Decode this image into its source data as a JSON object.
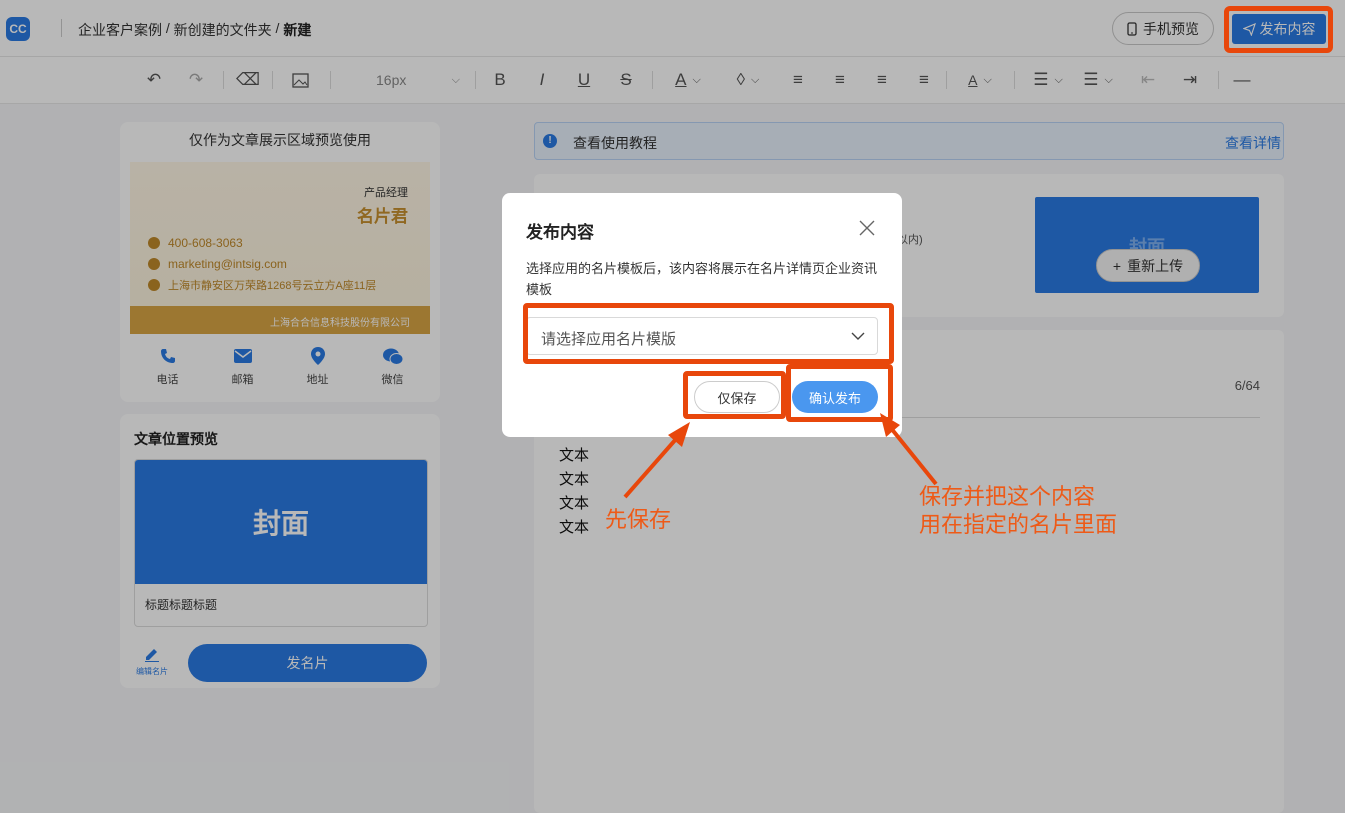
{
  "app": {
    "logo": "CC"
  },
  "breadcrumb": {
    "part1": "企业客户案例",
    "sep": " / ",
    "part2": "新创建的文件夹",
    "current": "新建"
  },
  "header": {
    "mobile_preview": "手机预览",
    "publish": "发布内容"
  },
  "toolbar": {
    "font_size": "16px",
    "icons": [
      "undo-icon",
      "redo-icon",
      "eraser-icon",
      "image-icon",
      "bold-icon",
      "italic-icon",
      "underline-icon",
      "strikethrough-icon",
      "font-color-icon",
      "highlight-icon",
      "align-left-icon",
      "align-center-icon",
      "align-right-icon",
      "justify-icon",
      "text-style-icon",
      "bullet-list-icon",
      "ordered-list-icon",
      "outdent-icon",
      "indent-icon",
      "divider-icon"
    ]
  },
  "card_preview": {
    "notice": "仅作为文章展示区域预览使用",
    "role": "产品经理",
    "name": "名片君",
    "phone": "400-608-3063",
    "email": "marketing@intsig.com",
    "address": "上海市静安区万荣路1268号云立方A座11层",
    "company": "上海合合信息科技股份有限公司",
    "actions": {
      "phone": "电话",
      "mail": "邮箱",
      "address": "地址",
      "wechat": "微信"
    }
  },
  "article_position": {
    "title": "文章位置预览",
    "cover": "封面",
    "caption": "标题标题标题",
    "edit_card": "编辑名片",
    "send_card": "发名片"
  },
  "banner": {
    "text": "查看使用教程",
    "link": "查看详情"
  },
  "editor": {
    "hint_fragment": "以内)",
    "cover_text": "封面",
    "reupload": "重新上传",
    "counter": "6/64",
    "body_lines": [
      "文本",
      "文本",
      "文本",
      "文本"
    ]
  },
  "modal": {
    "title": "发布内容",
    "description": "选择应用的名片模板后，该内容将展示在名片详情页企业资讯模板",
    "select_placeholder": "请选择应用名片模版",
    "save_only": "仅保存",
    "confirm": "确认发布"
  },
  "annotations": {
    "save_first": "先保存",
    "confirm_line1": "保存并把这个内容",
    "confirm_line2": "用在指定的名片里面"
  },
  "colors": {
    "accent": "#2a7be4",
    "annotation": "#e8470b"
  }
}
